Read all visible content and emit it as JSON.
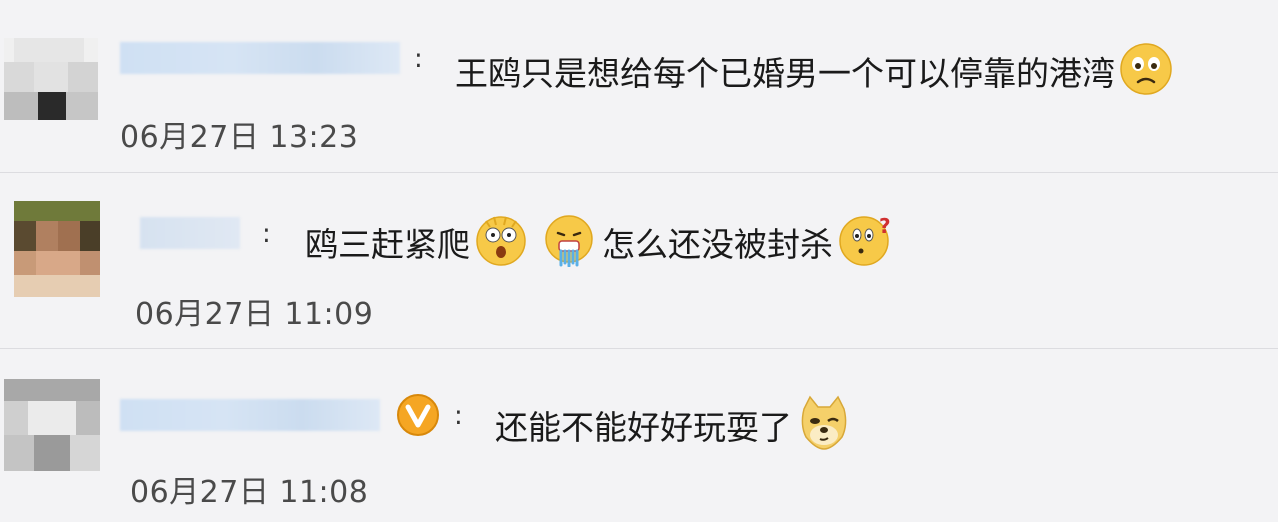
{
  "comments": [
    {
      "text": "王鸥只是想给每个已婚男一个可以停靠的港湾",
      "colon": ":",
      "timestamp": "06月27日 13:23",
      "emojis": [
        "sad-emoji"
      ]
    },
    {
      "text_a": "鸥三赶紧爬",
      "text_b": "怎么还没被封杀",
      "colon": ":",
      "timestamp": "06月27日 11:09",
      "emojis": [
        "shocked-emoji",
        "vomit-emoji",
        "confused-emoji"
      ]
    },
    {
      "text": "还能不能好好玩耍了",
      "colon": ":",
      "timestamp": "06月27日 11:08",
      "emojis": [
        "doge-emoji"
      ],
      "badge": "verified-v-icon"
    }
  ],
  "colors": {
    "background": "#f3f3f5",
    "divider": "#dcdce0",
    "username_blur": "#cfe0f3",
    "emoji_yellow": "#f7c948",
    "badge_orange": "#f5a623"
  }
}
